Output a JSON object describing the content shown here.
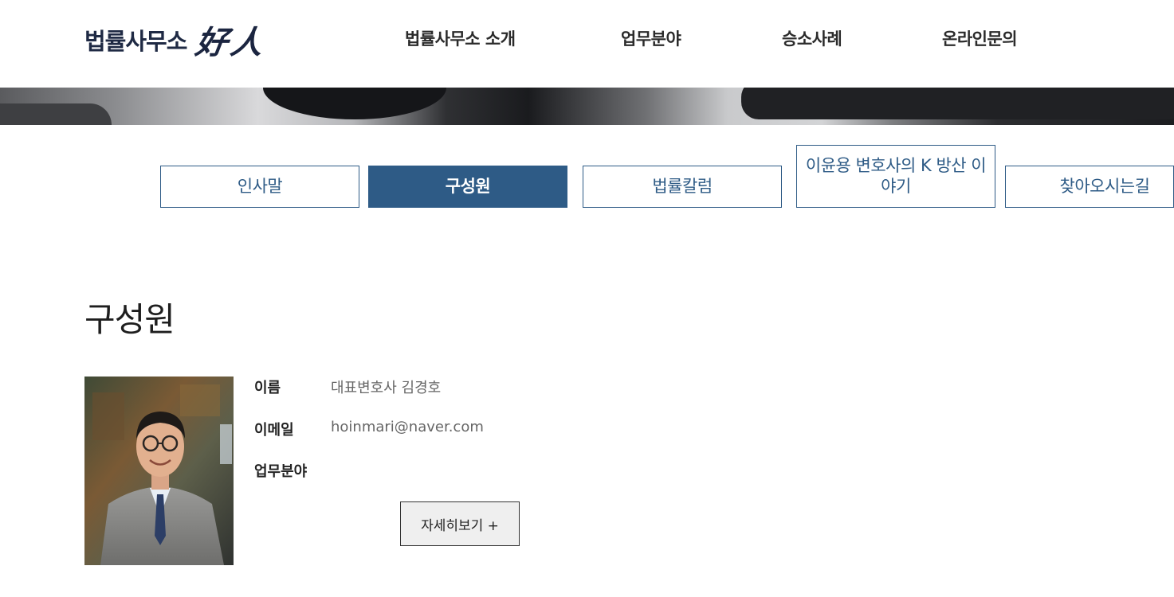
{
  "header": {
    "logo_text": "법률사무소",
    "logo_mark": "好人",
    "nav": [
      {
        "label": "법률사무소 소개"
      },
      {
        "label": "업무분야"
      },
      {
        "label": "승소사례"
      },
      {
        "label": "온라인문의"
      }
    ]
  },
  "tabs": [
    {
      "label": "인사말",
      "active": false
    },
    {
      "label": "구성원",
      "active": true
    },
    {
      "label": "법률칼럼",
      "active": false
    },
    {
      "label": "이윤용 변호사의 K 방산 이야기",
      "active": false
    },
    {
      "label": "찾아오시는길",
      "active": false
    }
  ],
  "content": {
    "title": "구성원",
    "member": {
      "photo_icon": "portrait-photo",
      "fields": [
        {
          "label": "이름",
          "value": "대표변호사 김경호"
        },
        {
          "label": "이메일",
          "value": "hoinmari@naver.com"
        },
        {
          "label": "업무분야",
          "value": ""
        }
      ],
      "detail_button": "자세히보기 +"
    }
  },
  "colors": {
    "accent": "#2e5b86",
    "logo": "#1f2a44",
    "nav_text": "#2b2b2b"
  }
}
